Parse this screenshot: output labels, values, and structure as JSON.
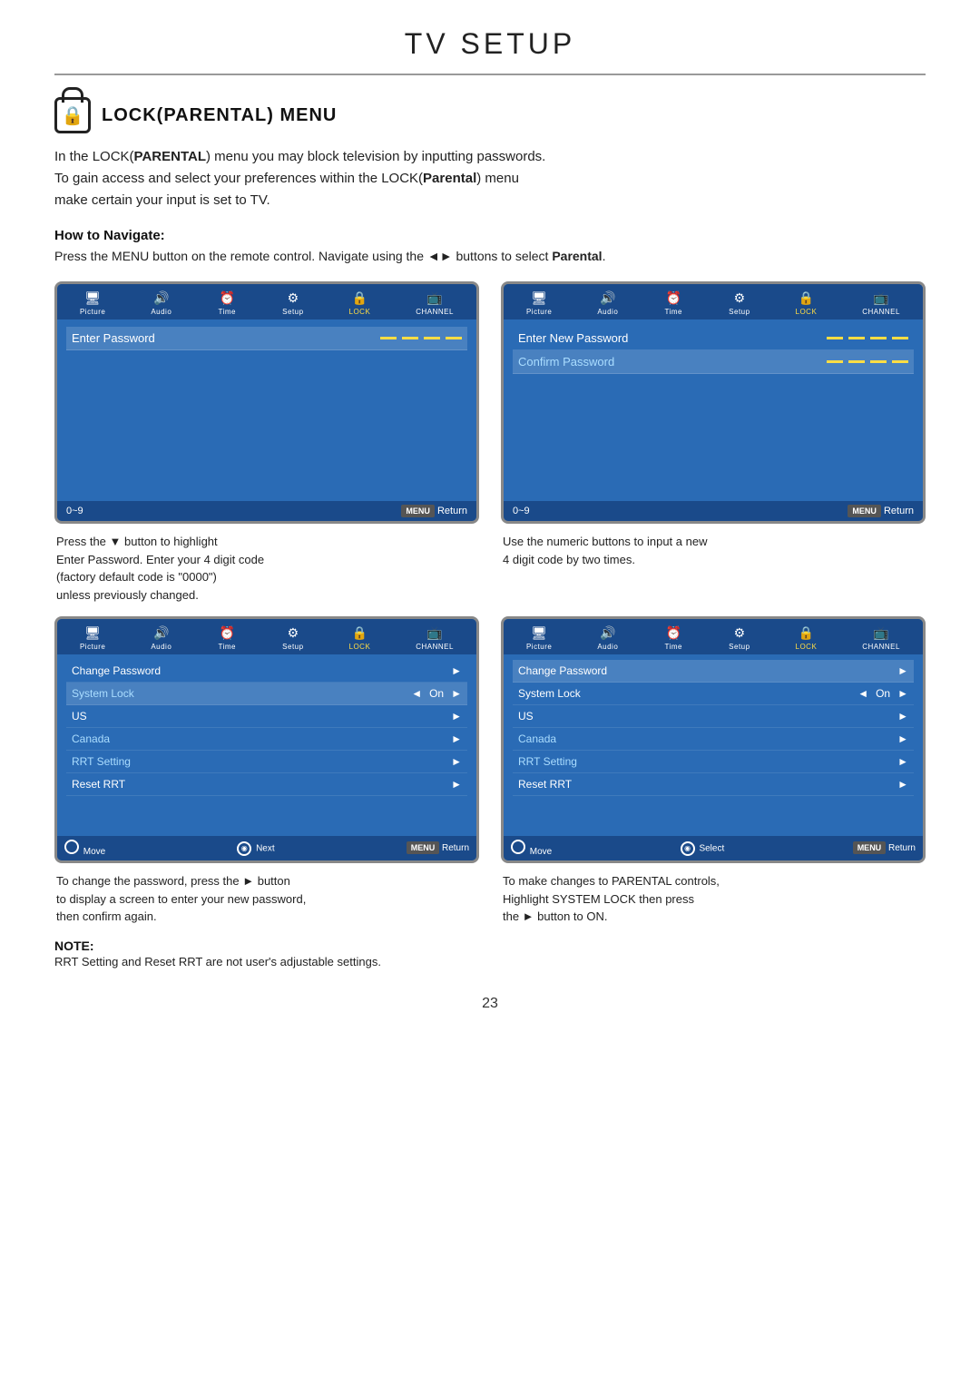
{
  "page": {
    "title": "TV SETUP",
    "number": "23"
  },
  "section": {
    "title": "LOCK(PARENTAL) MENU",
    "description_line1": "In the LOCK(",
    "description_bold1": "PARENTAL",
    "description_line1b": ") menu you may block television by inputting passwords.",
    "description_line2": "To gain access and select your preferences within the LOCK(",
    "description_bold2": "Parental",
    "description_line2b": ") menu",
    "description_line3": "make certain your input is set to TV.",
    "how_to_label": "How to Navigate:",
    "navigate_text": "Press the MENU button on the remote control. Navigate using the ◄► buttons to select ",
    "navigate_bold": "Parental",
    "navigate_end": "."
  },
  "menu_items": {
    "picture": "Picture",
    "audio": "Audio",
    "time": "Time",
    "setup": "Setup",
    "lock": "LOCK",
    "channel": "CHANNEL"
  },
  "screen1": {
    "title": "Enter Password",
    "bottom_left": "0~9",
    "bottom_right": "Return",
    "caption_line1": "Press the ▼ button to highlight",
    "caption_line2": "Enter Password. Enter your 4 digit code",
    "caption_line3": "(factory default code is \"0000\")",
    "caption_line4": "unless previously changed."
  },
  "screen2": {
    "row1": "Enter New Password",
    "row2": "Confirm Password",
    "bottom_left": "0~9",
    "bottom_right": "Return",
    "caption_line1": "Use the numeric buttons to input a new",
    "caption_line2": "4 digit code by two times."
  },
  "screen3": {
    "rows": [
      {
        "label": "Change Password",
        "value": "",
        "arrow": "►",
        "highlighted": false,
        "cyan": false
      },
      {
        "label": "System Lock",
        "left_arrow": "◄",
        "value": "On",
        "arrow": "►",
        "highlighted": true,
        "cyan": true
      },
      {
        "label": "US",
        "value": "",
        "arrow": "►",
        "highlighted": false,
        "cyan": false
      },
      {
        "label": "Canada",
        "value": "",
        "arrow": "►",
        "highlighted": false,
        "cyan": true
      },
      {
        "label": "RRT Setting",
        "value": "",
        "arrow": "►",
        "highlighted": false,
        "cyan": true
      },
      {
        "label": "Reset RRT",
        "value": "",
        "arrow": "►",
        "highlighted": false,
        "cyan": false
      }
    ],
    "bottom_left": "Move",
    "bottom_mid": "Next",
    "bottom_right": "Return",
    "caption_line1": "To change the password, press the ► button",
    "caption_line2": "to display a screen to enter your new password,",
    "caption_line3": "then confirm again."
  },
  "screen4": {
    "rows": [
      {
        "label": "Change Password",
        "value": "",
        "arrow": "►",
        "highlighted": true,
        "cyan": false
      },
      {
        "label": "System Lock",
        "left_arrow": "◄",
        "value": "On",
        "arrow": "►",
        "highlighted": false,
        "cyan": false
      },
      {
        "label": "US",
        "value": "",
        "arrow": "►",
        "highlighted": false,
        "cyan": false
      },
      {
        "label": "Canada",
        "value": "",
        "arrow": "►",
        "highlighted": false,
        "cyan": true
      },
      {
        "label": "RRT Setting",
        "value": "",
        "arrow": "►",
        "highlighted": false,
        "cyan": true
      },
      {
        "label": "Reset RRT",
        "value": "",
        "arrow": "►",
        "highlighted": false,
        "cyan": false
      }
    ],
    "bottom_left": "Move",
    "bottom_mid": "Select",
    "bottom_right": "Return",
    "caption_line1": "To make changes to PARENTAL controls,",
    "caption_line2": "Highlight SYSTEM LOCK then press",
    "caption_line3": "the ► button to ON."
  },
  "note": {
    "title": "NOTE:",
    "text": "RRT Setting and Reset RRT are not user's adjustable settings."
  }
}
